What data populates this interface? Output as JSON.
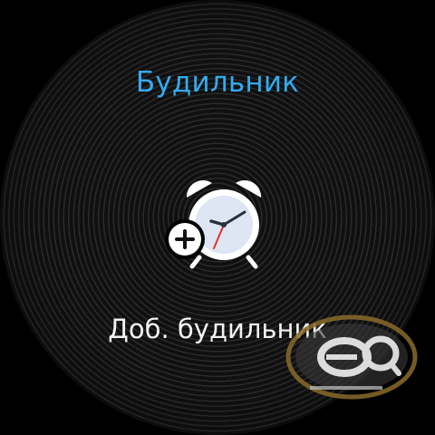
{
  "header": {
    "title": "Будильник"
  },
  "main": {
    "add_alarm_label": "Доб. будильник",
    "add_alarm_icon": "alarm-clock-plus-icon"
  },
  "colors": {
    "title_accent": "#33aaf0",
    "clock_second_hand": "#e0302a",
    "clock_face": "#dde6f2"
  },
  "watermark": {
    "letters": "eq"
  }
}
